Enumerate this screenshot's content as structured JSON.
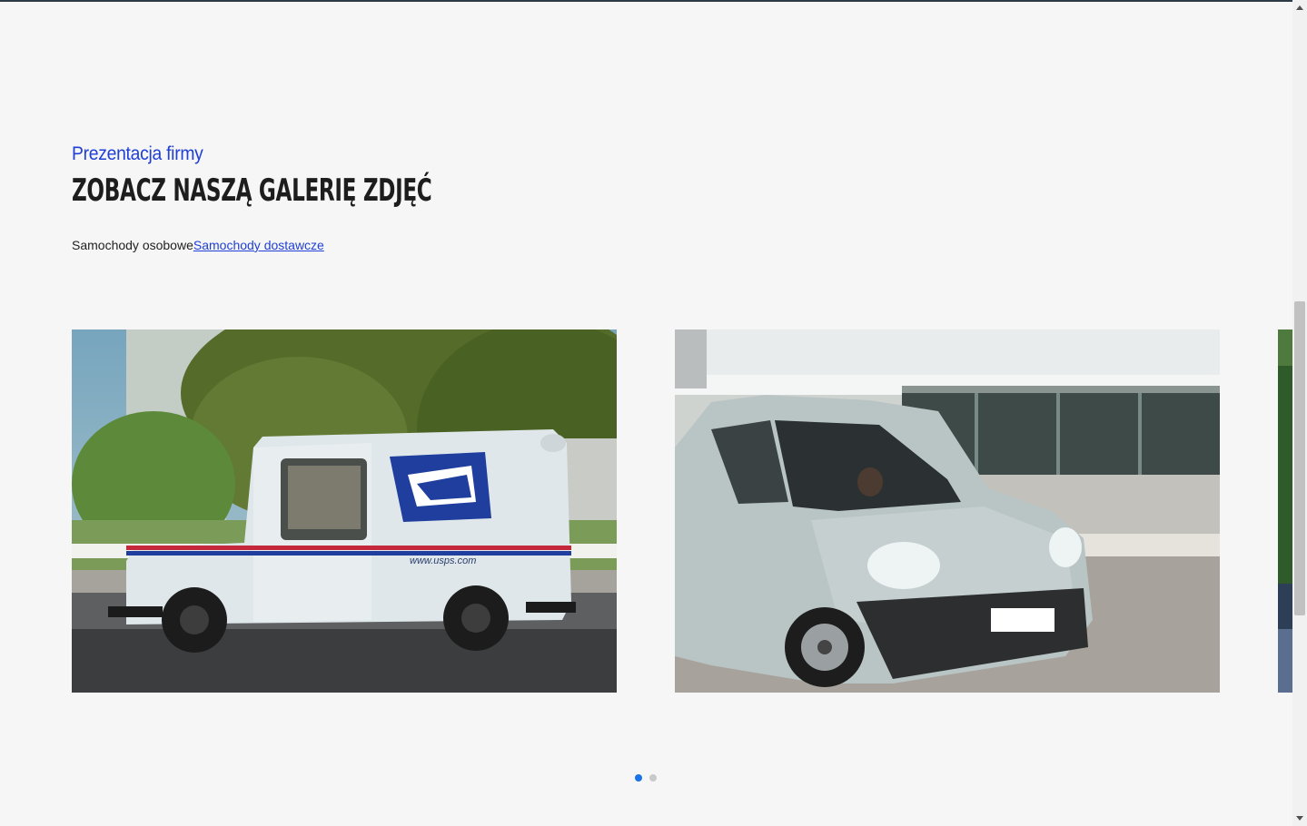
{
  "gallery": {
    "eyebrow": "Prezentacja firmy",
    "title": "Zobacz naszą galerię zdjęć",
    "tabs": [
      {
        "label": "Samochody osobowe",
        "active": false
      },
      {
        "label": "Samochody dostawcze",
        "active": true
      }
    ],
    "slides": [
      {
        "alt": "white mail delivery truck",
        "text": "www.usps.com"
      },
      {
        "alt": "light grey delivery van"
      },
      {
        "alt": "partial next slide"
      }
    ],
    "pagination": {
      "total": 2,
      "current": 1
    }
  },
  "colors": {
    "accent": "#1f3fd6",
    "dot_active": "#1a73e8",
    "background": "#f6f6f6"
  }
}
